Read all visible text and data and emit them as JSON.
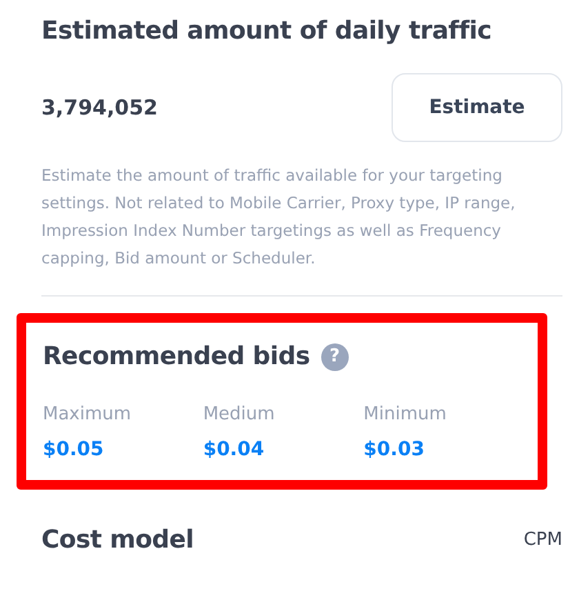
{
  "traffic": {
    "title": "Estimated amount of daily traffic",
    "value": "3,794,052",
    "button": "Estimate",
    "description": "Estimate the amount of traffic available for your targeting settings. Not related to Mobile Carrier, Proxy type, IP range, Impression Index Number targetings as well as Frequency capping, Bid amount or Scheduler."
  },
  "bids": {
    "title": "Recommended bids",
    "help_icon": "?",
    "highlighted": true,
    "items": [
      {
        "label": "Maximum",
        "value": "$0.05"
      },
      {
        "label": "Medium",
        "value": "$0.04"
      },
      {
        "label": "Minimum",
        "value": "$0.03"
      }
    ]
  },
  "cost_model": {
    "label": "Cost model",
    "value": "CPM"
  }
}
